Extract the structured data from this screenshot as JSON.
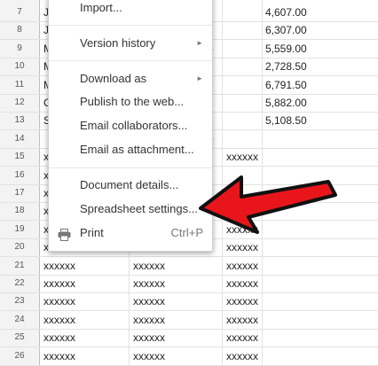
{
  "rows": [
    {
      "num": "7",
      "a": "J",
      "b": "",
      "c_frag": "2",
      "d": "4,607.00"
    },
    {
      "num": "8",
      "a": "J",
      "b": "",
      "c_frag": "2",
      "d": "6,307.00"
    },
    {
      "num": "9",
      "a": "M",
      "b": "",
      "c_frag": "4",
      "d": "5,559.00"
    },
    {
      "num": "10",
      "a": "M",
      "b": "",
      "c_frag": "1",
      "d": "2,728.50"
    },
    {
      "num": "11",
      "a": "M",
      "b": "",
      "c_frag": "9",
      "d": "6,791.50"
    },
    {
      "num": "12",
      "a": "C",
      "b": "",
      "c_frag": "2",
      "d": "5,882.00"
    },
    {
      "num": "13",
      "a": "S",
      "b": "",
      "c_frag": "1",
      "d": "5,108.50"
    },
    {
      "num": "14",
      "a": "",
      "b": "",
      "c_frag": "0",
      "d": ""
    },
    {
      "num": "15",
      "a": "x",
      "b": "",
      "c": "xxxxxx"
    },
    {
      "num": "16",
      "a": "x",
      "b": "",
      "c": ""
    },
    {
      "num": "17",
      "a": "x",
      "b": "",
      "c": ""
    },
    {
      "num": "18",
      "a": "x",
      "b": "",
      "c": "xxxxxx"
    },
    {
      "num": "19",
      "a": "x",
      "b": "",
      "c": "xxxxxx"
    },
    {
      "num": "20",
      "a": "xxxxxx",
      "b": "xxxxxx",
      "c": "xxxxxx"
    },
    {
      "num": "21",
      "a": "xxxxxx",
      "b": "xxxxxx",
      "c": "xxxxxx"
    },
    {
      "num": "22",
      "a": "xxxxxx",
      "b": "xxxxxx",
      "c": "xxxxxx"
    },
    {
      "num": "23",
      "a": "xxxxxx",
      "b": "xxxxxx",
      "c": "xxxxxx"
    },
    {
      "num": "24",
      "a": "xxxxxx",
      "b": "xxxxxx",
      "c": "xxxxxx"
    },
    {
      "num": "25",
      "a": "xxxxxx",
      "b": "xxxxxx",
      "c": "xxxxxx"
    },
    {
      "num": "26",
      "a": "xxxxxx",
      "b": "xxxxxx",
      "c": "xxxxxx"
    }
  ],
  "menu": {
    "import": "Import...",
    "version_history": "Version history",
    "download_as": "Download as",
    "publish": "Publish to the web...",
    "email_collaborators": "Email collaborators...",
    "email_attachment": "Email as attachment...",
    "document_details": "Document details...",
    "spreadsheet_settings": "Spreadsheet settings...",
    "print": "Print",
    "print_shortcut": "Ctrl+P",
    "submenu_arrow": "►"
  },
  "colors": {
    "arrow_red": "#e8161b",
    "arrow_outline": "#111111"
  },
  "icons": {
    "print": "printer-icon"
  }
}
